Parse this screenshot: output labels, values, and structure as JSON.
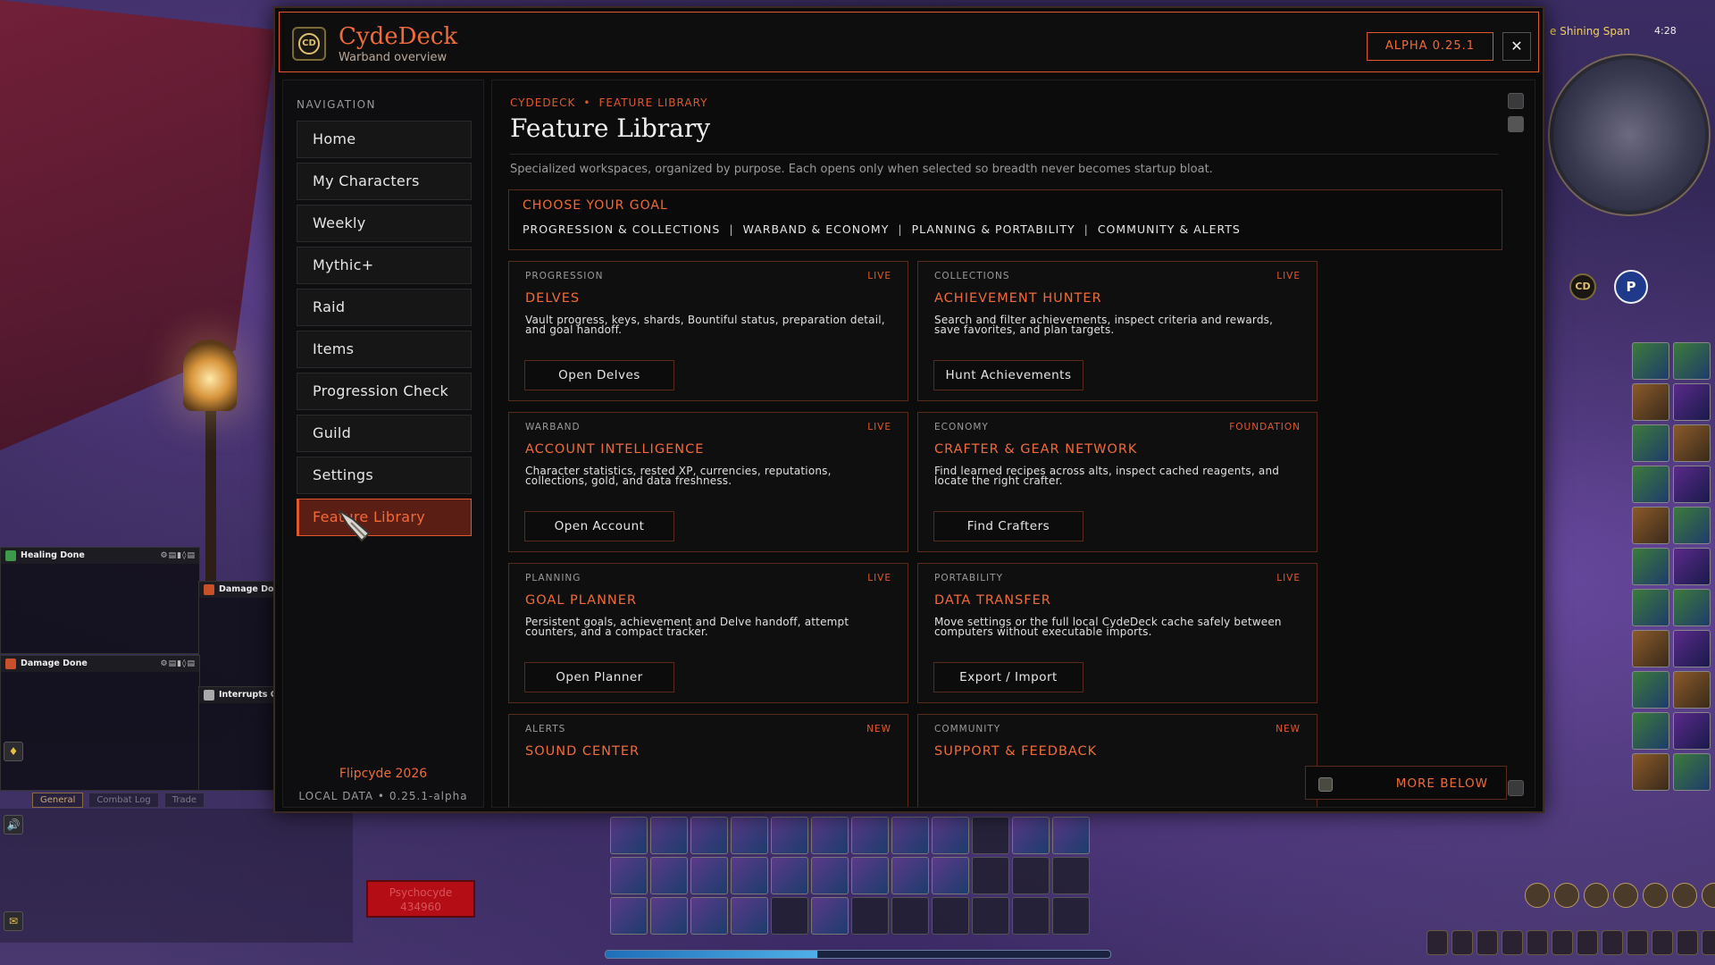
{
  "app": {
    "title": "CydeDeck",
    "subtitle": "Warband overview",
    "logo_text": "CD",
    "version": "ALPHA 0.25.1",
    "close_glyph": "✕"
  },
  "navigation": {
    "heading": "NAVIGATION",
    "items": [
      {
        "label": "Home"
      },
      {
        "label": "My Characters"
      },
      {
        "label": "Weekly"
      },
      {
        "label": "Mythic+"
      },
      {
        "label": "Raid"
      },
      {
        "label": "Items"
      },
      {
        "label": "Progression Check"
      },
      {
        "label": "Guild"
      },
      {
        "label": "Settings"
      },
      {
        "label": "Feature Library",
        "active": true
      }
    ],
    "footer_brand": "Flipcyde 2026",
    "footer_meta": "LOCAL DATA  •  0.25.1-alpha"
  },
  "main": {
    "breadcrumb": [
      "CYDEDECK",
      "FEATURE LIBRARY"
    ],
    "breadcrumb_sep": "•",
    "title": "Feature Library",
    "description": "Specialized workspaces, organized by purpose. Each opens only when selected so breadth never becomes startup bloat.",
    "goal": {
      "heading": "CHOOSE YOUR GOAL",
      "links": [
        "PROGRESSION & COLLECTIONS",
        "WARBAND & ECONOMY",
        "PLANNING & PORTABILITY",
        "COMMUNITY & ALERTS"
      ],
      "pipe": "|"
    },
    "cards": [
      {
        "category": "PROGRESSION",
        "status": "LIVE",
        "title": "DELVES",
        "description": "Vault progress, keys, shards, Bountiful status, preparation detail, and goal handoff.",
        "button": "Open Delves"
      },
      {
        "category": "COLLECTIONS",
        "status": "LIVE",
        "title": "ACHIEVEMENT HUNTER",
        "description": "Search and filter achievements, inspect criteria and rewards, save favorites, and plan targets.",
        "button": "Hunt Achievements"
      },
      {
        "category": "WARBAND",
        "status": "LIVE",
        "title": "ACCOUNT INTELLIGENCE",
        "description": "Character statistics, rested XP, currencies, reputations, collections, gold, and data freshness.",
        "button": "Open Account"
      },
      {
        "category": "ECONOMY",
        "status": "FOUNDATION",
        "title": "CRAFTER & GEAR NETWORK",
        "description": "Find learned recipes across alts, inspect cached reagents, and locate the right crafter.",
        "button": "Find Crafters"
      },
      {
        "category": "PLANNING",
        "status": "LIVE",
        "title": "GOAL PLANNER",
        "description": "Persistent goals, achievement and Delve handoff, attempt counters, and a compact tracker.",
        "button": "Open Planner"
      },
      {
        "category": "PORTABILITY",
        "status": "LIVE",
        "title": "DATA TRANSFER",
        "description": "Move settings or the full local CydeDeck cache safely between computers without executable imports.",
        "button": "Export / Import"
      },
      {
        "category": "ALERTS",
        "status": "NEW",
        "title": "SOUND CENTER",
        "description": "",
        "button": ""
      },
      {
        "category": "COMMUNITY",
        "status": "NEW",
        "title": "SUPPORT & FEEDBACK",
        "description": "",
        "button": ""
      }
    ],
    "more_below": "MORE BELOW"
  },
  "game_ui": {
    "healing_panel": "Healing Done",
    "damage_panel": "Damage Done",
    "damage_panel_2": "Damage Done",
    "interrupts_panel": "Interrupts Over",
    "chat_tabs": [
      "General",
      "Combat Log",
      "Trade"
    ],
    "unit_frame_name": "Psychocyde",
    "unit_frame_value": "434960",
    "zone": "e Shining Span",
    "clock": "4:28",
    "map_badge_cd": "CD",
    "map_badge_p": "P",
    "xp_fraction": 0.42,
    "colors": {
      "accent": "#f06a3a",
      "border": "#5a2a1a",
      "panel_bg": "#0b0b0c"
    }
  }
}
